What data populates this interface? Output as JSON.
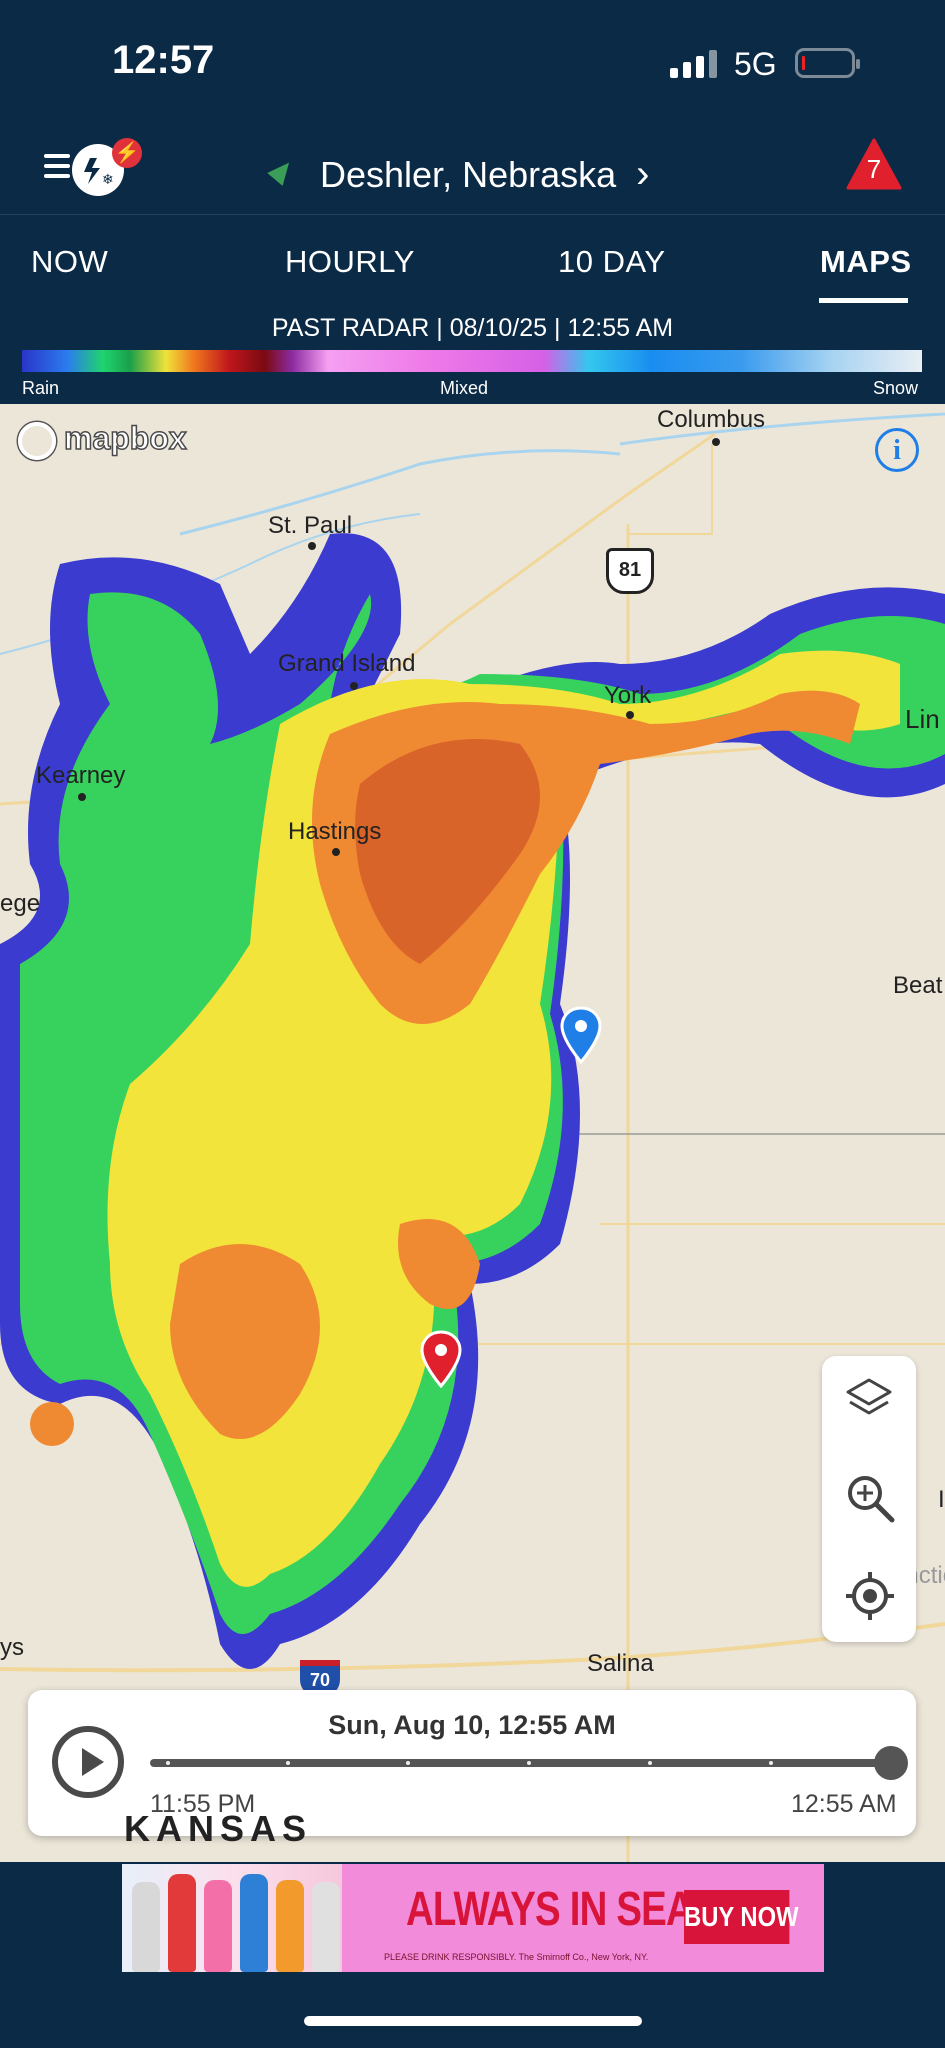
{
  "status_bar": {
    "time": "12:57",
    "network": "5G"
  },
  "header": {
    "location": "Deshler,  Nebraska",
    "location_chevron": "›",
    "alert_count": "7"
  },
  "tabs": [
    {
      "label": "NOW",
      "active": false
    },
    {
      "label": "HOURLY",
      "active": false
    },
    {
      "label": "10  DAY",
      "active": false
    },
    {
      "label": "MAPS",
      "active": true
    }
  ],
  "radar": {
    "title": "PAST RADAR | 08/10/25 | 12:55 AM",
    "legend": {
      "rain": "Rain",
      "mixed": "Mixed",
      "snow": "Snow"
    }
  },
  "map": {
    "attribution": "mapbox",
    "cities": [
      "Columbus",
      "St. Paul",
      "Grand Island",
      "York",
      "Kearney",
      "Hastings",
      "Salina",
      "Lin",
      "Beat",
      "ege",
      "ys",
      "Junction C",
      "I"
    ],
    "shields": [
      "81",
      "70"
    ],
    "state_label": "KANSAS",
    "icons": [
      "layers-icon",
      "zoom-in-icon",
      "locate-icon",
      "info-icon"
    ]
  },
  "timeline": {
    "current": "Sun, Aug 10, 12:55 AM",
    "start": "11:55 PM",
    "end": "12:55 AM",
    "progress": 1.0
  },
  "ad": {
    "headline": "ALWAYS IN SEASON",
    "cta": "BUY NOW",
    "fine_print": "PLEASE DRINK RESPONSIBLY. The Smirnoff Co., New York, NY."
  }
}
